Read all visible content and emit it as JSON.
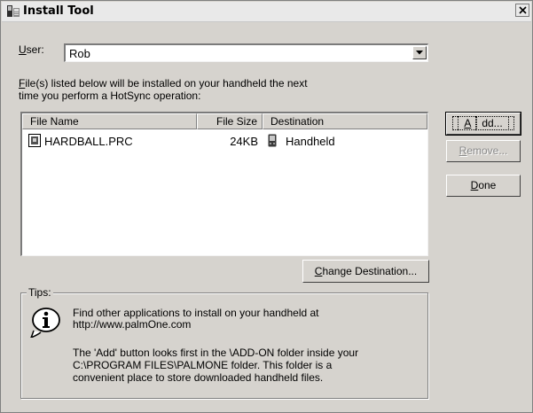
{
  "window": {
    "title": "Install Tool",
    "close_label": "×"
  },
  "user": {
    "label_prefix": "U",
    "label_rest": "ser:",
    "value": "Rob"
  },
  "instructions": {
    "line1_prefix": "F",
    "line1_rest": "ile(s) listed below will be installed on your handheld the next",
    "line2": "time you perform a HotSync operation:"
  },
  "file_list": {
    "columns": [
      "File Name",
      "File Size",
      "Destination"
    ],
    "rows": [
      {
        "name": "HARDBALL.PRC",
        "size": "24KB",
        "destination": "Handheld"
      }
    ]
  },
  "buttons": {
    "add_prefix": "A",
    "add_rest": "dd...",
    "remove_prefix": "R",
    "remove_rest": "emove...",
    "done_prefix": "D",
    "done_rest": "one",
    "change_prefix": "C",
    "change_rest": "hange Destination..."
  },
  "tips": {
    "legend": "Tips:",
    "tip1_line1": "Find other applications to install on your handheld at",
    "tip1_line2": "http://www.palmOne.com",
    "tip2_line1": "The 'Add' button looks first in the \\ADD-ON folder inside your",
    "tip2_line2": "C:\\PROGRAM FILES\\PALMONE folder. This folder is a",
    "tip2_line3": "convenient place to store downloaded handheld files."
  },
  "colors": {
    "dialog_bg": "#d6d3ce",
    "disabled_text": "#8a8a8a"
  }
}
